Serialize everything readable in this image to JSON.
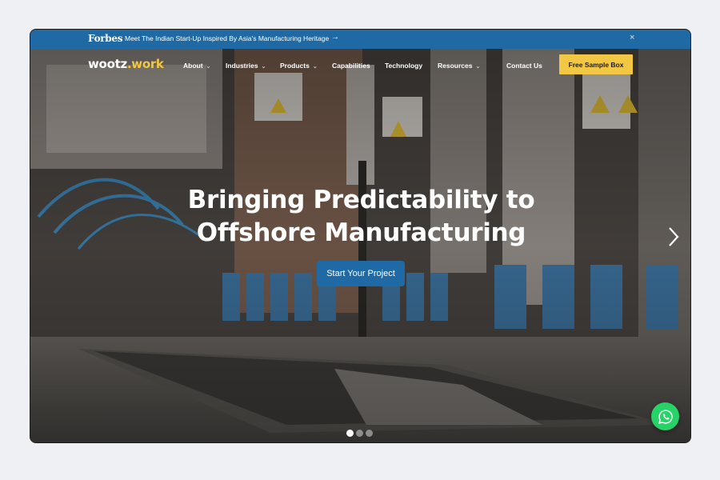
{
  "announcement": {
    "brand": "Forbes",
    "text": "Meet The Indian Start-Up Inspired By Asia's Manufacturing Heritage",
    "arrow": "→",
    "close": "×"
  },
  "nav": {
    "logo_prefix": "wootz",
    "logo_suffix": ".work",
    "items": [
      {
        "label": "About",
        "dropdown": true
      },
      {
        "label": "Industries",
        "dropdown": true
      },
      {
        "label": "Products",
        "dropdown": true
      },
      {
        "label": "Capabilities",
        "dropdown": false
      },
      {
        "label": "Technology",
        "dropdown": false
      },
      {
        "label": "Resources",
        "dropdown": true
      }
    ],
    "contact": "Contact Us",
    "cta": "Free Sample Box"
  },
  "hero": {
    "headline_line1": "Bringing Predictability to",
    "headline_line2": "Offshore Manufacturing",
    "button": "Start Your Project",
    "slides_total": 3,
    "slide_active": 1
  },
  "icons": {
    "next": "chevron-right-icon",
    "chat": "whatsapp-icon",
    "chevron": "chevron-down-icon"
  },
  "colors": {
    "brand_blue": "#1f6aa5",
    "accent_yellow": "#f2c744",
    "whatsapp_green": "#25d366"
  }
}
